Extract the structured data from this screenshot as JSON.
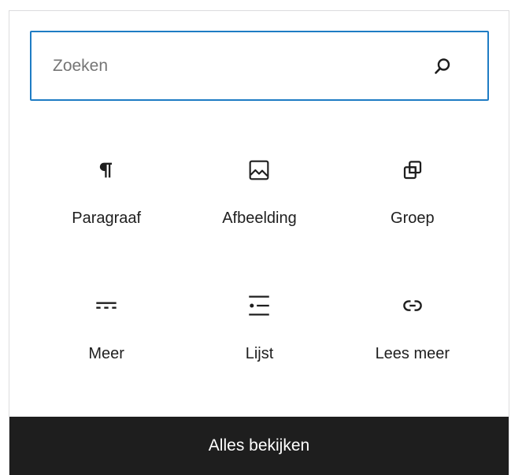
{
  "search": {
    "placeholder": "Zoeken",
    "value": "",
    "icon": "search-icon"
  },
  "blocks": [
    {
      "label": "Paragraaf",
      "icon": "paragraph-icon"
    },
    {
      "label": "Afbeelding",
      "icon": "image-icon"
    },
    {
      "label": "Groep",
      "icon": "group-icon"
    },
    {
      "label": "Meer",
      "icon": "more-icon"
    },
    {
      "label": "Lijst",
      "icon": "list-icon"
    },
    {
      "label": "Lees meer",
      "icon": "read-more-icon"
    }
  ],
  "footer": {
    "browse_all_label": "Alles bekijken"
  },
  "colors": {
    "focus_border": "#1e7cc4",
    "footer_background": "#1e1e1e",
    "text": "#1e1e1e",
    "placeholder": "#757575"
  }
}
